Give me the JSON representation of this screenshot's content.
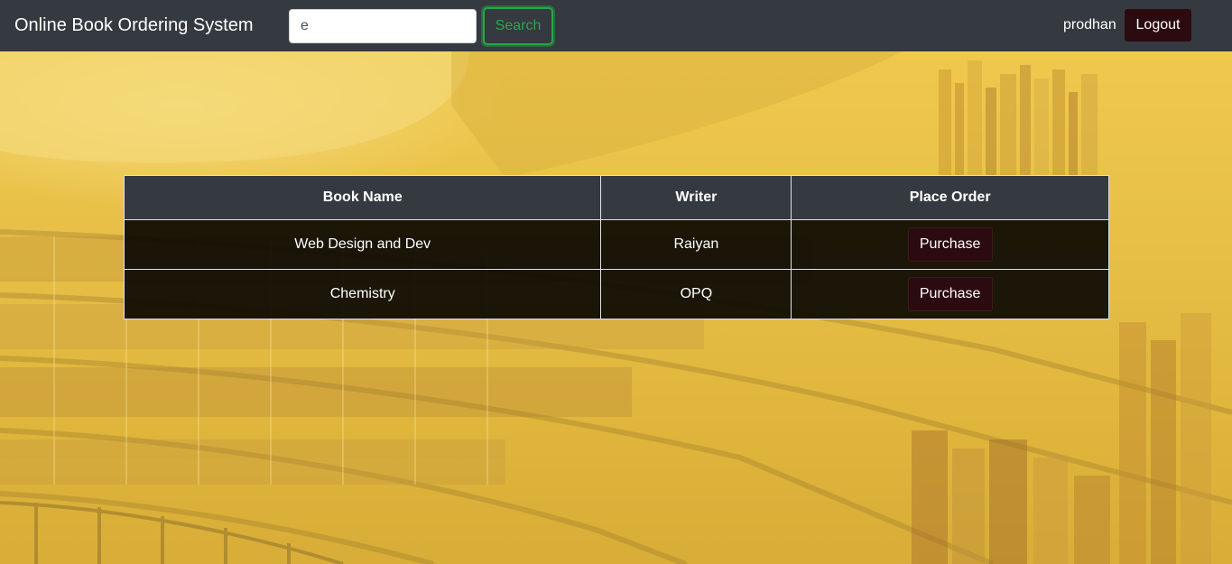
{
  "navbar": {
    "brand": "Online Book Ordering System",
    "search": {
      "value": "e",
      "button_label": "Search"
    },
    "username": "prodhan",
    "logout_label": "Logout"
  },
  "table": {
    "headers": [
      "Book Name",
      "Writer",
      "Place Order"
    ],
    "rows": [
      {
        "book_name": "Web Design and Dev",
        "writer": "Raiyan",
        "action_label": "Purchase"
      },
      {
        "book_name": "Chemistry",
        "writer": "OPQ",
        "action_label": "Purchase"
      }
    ]
  },
  "colors": {
    "navbar_bg": "#343a40",
    "search_accent": "#28a745",
    "button_dark": "#2c0b10",
    "background_tint": "#e2b93c"
  }
}
